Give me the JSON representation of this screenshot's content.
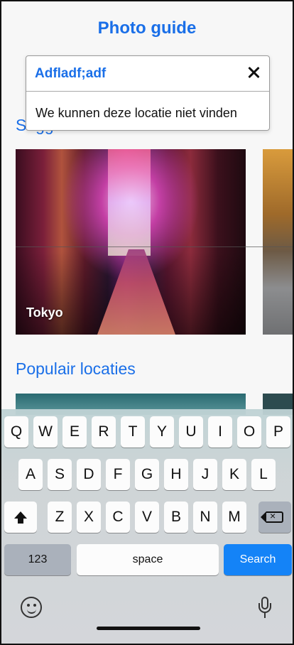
{
  "app": {
    "title": "Photo guide"
  },
  "sections": [
    {
      "title": "Suggested locations"
    },
    {
      "title": "Populair locaties"
    }
  ],
  "cards": [
    {
      "label": "Tokyo"
    }
  ],
  "search": {
    "value": "Adfladf;adf",
    "error": "We kunnen deze locatie niet vinden"
  },
  "keyboard": {
    "row1": [
      "Q",
      "W",
      "E",
      "R",
      "T",
      "Y",
      "U",
      "I",
      "O",
      "P"
    ],
    "row2": [
      "A",
      "S",
      "D",
      "F",
      "G",
      "H",
      "J",
      "K",
      "L"
    ],
    "row3": [
      "Z",
      "X",
      "C",
      "V",
      "B",
      "N",
      "M"
    ],
    "numbers_label": "123",
    "space_label": "space",
    "search_label": "Search"
  },
  "colors": {
    "accent": "#1a6fe8",
    "search_key": "#1483f7"
  }
}
